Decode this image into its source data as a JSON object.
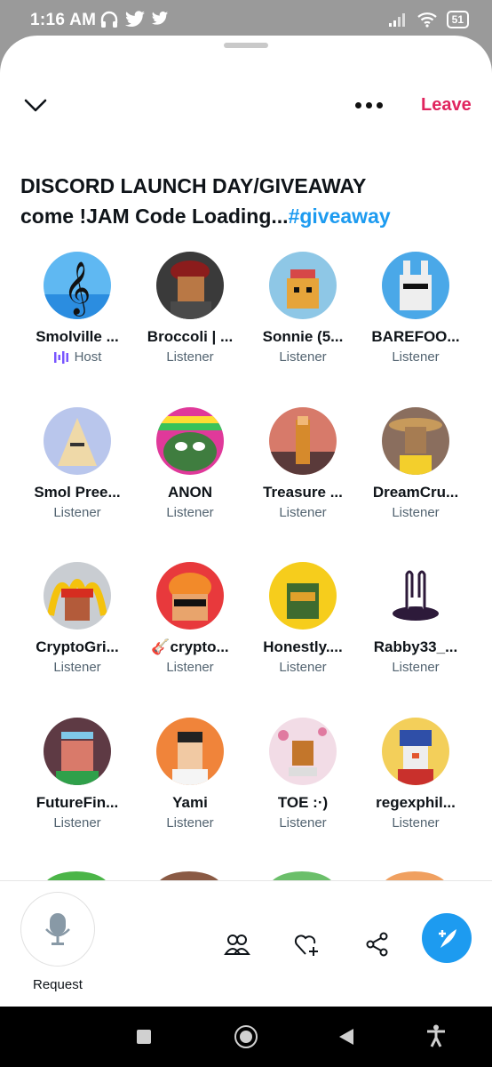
{
  "status_bar": {
    "time": "1:16 AM",
    "battery": "51"
  },
  "header": {
    "leave_label": "Leave"
  },
  "space": {
    "title_line1": "DISCORD LAUNCH DAY/GIVEAWAY",
    "title_line2": "come !JAM Code Loading...",
    "hashtag": "#giveaway"
  },
  "participants": [
    {
      "name": "Smolville ...",
      "role": "Host"
    },
    {
      "name": "Broccoli | ...",
      "role": "Listener"
    },
    {
      "name": "Sonnie (5...",
      "role": "Listener"
    },
    {
      "name": "BAREFOO...",
      "role": "Listener"
    },
    {
      "name": "Smol Pree...",
      "role": "Listener"
    },
    {
      "name": "ANON",
      "role": "Listener"
    },
    {
      "name": "Treasure ...",
      "role": "Listener"
    },
    {
      "name": "DreamCru...",
      "role": "Listener"
    },
    {
      "name": "CryptoGri...",
      "role": "Listener"
    },
    {
      "name": "crypto...",
      "role": "Listener"
    },
    {
      "name": "Honestly....",
      "role": "Listener"
    },
    {
      "name": "Rabby33_...",
      "role": "Listener"
    },
    {
      "name": "FutureFin...",
      "role": "Listener"
    },
    {
      "name": "Yami",
      "role": "Listener"
    },
    {
      "name": "TOE :·)",
      "role": "Listener"
    },
    {
      "name": "regexphil...",
      "role": "Listener"
    }
  ],
  "bottom_bar": {
    "request_label": "Request"
  },
  "colors": {
    "accent": "#1d9bf0",
    "leave": "#e0245e",
    "host": "#7856ff"
  }
}
